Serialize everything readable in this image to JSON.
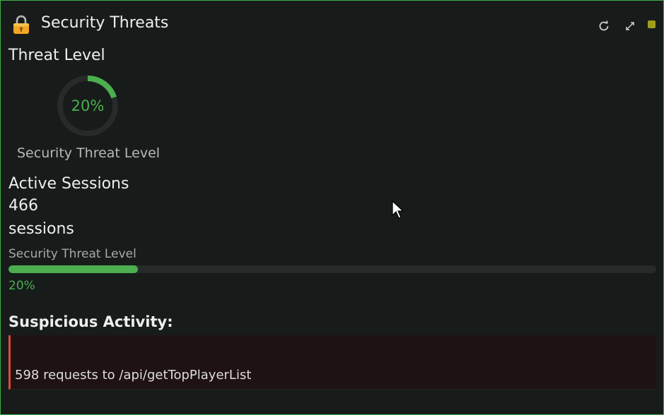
{
  "header": {
    "title": "Security Threats",
    "icons": [
      "lock-icon",
      "refresh-icon",
      "expand-icon"
    ],
    "status_color": "#a39d1d"
  },
  "threat_level": {
    "section_title": "Threat Level",
    "gauge_value_pct": 20,
    "gauge_text": "20%",
    "gauge_caption": "Security Threat Level"
  },
  "active_sessions": {
    "section_title": "Active Sessions",
    "count": "466",
    "unit": "sessions",
    "bar_label": "Security Threat Level",
    "bar_value_pct": 20,
    "bar_value_text": "20%"
  },
  "suspicious": {
    "section_title": "Suspicious Activity:",
    "message": "598 requests to /api/getTopPlayerList"
  },
  "colors": {
    "accent": "#4cae4f",
    "border": "#3fae49",
    "alert": "#e04a3a",
    "background": "#171c1a"
  }
}
